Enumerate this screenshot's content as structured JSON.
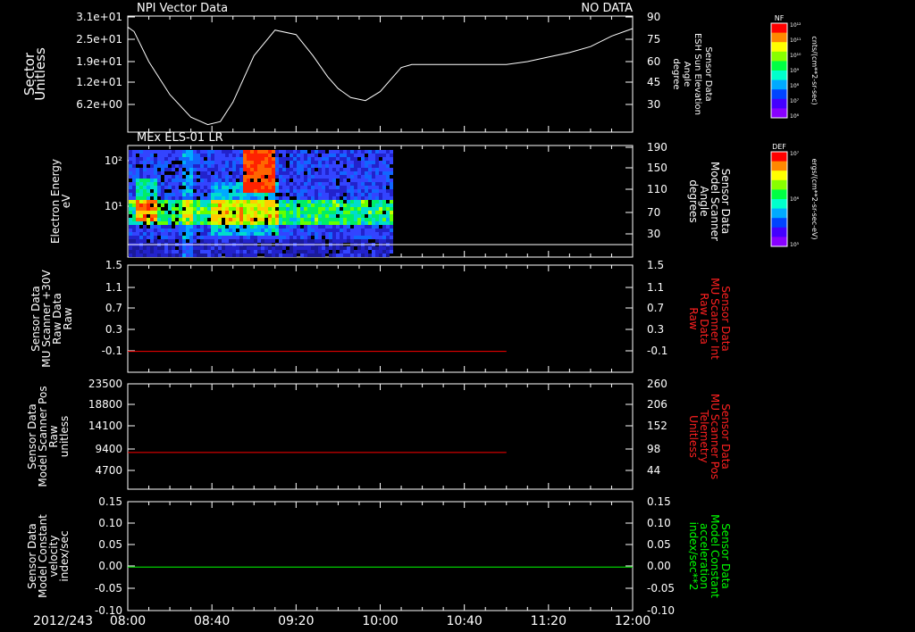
{
  "chart_data": [
    {
      "type": "line",
      "title": "NPI Vector Data",
      "status": "NO DATA",
      "ylabel": [
        "Sector",
        "Unitless"
      ],
      "y_ticks": [
        "3.1e+01",
        "2.5e+01",
        "1.9e+01",
        "1.2e+01",
        "6.2e+00"
      ],
      "ylim": [
        0,
        31
      ],
      "y2label": [
        "Sensor Data",
        "ESH Sun Elevation",
        "Angle",
        "degree"
      ],
      "y2_ticks": [
        "90",
        "75",
        "60",
        "45",
        "30"
      ],
      "y2lim": [
        15,
        90
      ],
      "series": [
        {
          "color": "#ffffff",
          "axis": "right",
          "x": [
            480,
            483,
            490,
            500,
            510,
            518,
            524,
            530,
            540,
            550,
            560,
            568,
            575,
            580,
            586,
            593,
            600,
            610,
            615,
            620,
            660,
            700,
            685,
            690,
            692,
            695,
            698,
            700,
            705,
            715,
            720
          ],
          "y": [
            85,
            82,
            62,
            40,
            25,
            20,
            22,
            35,
            66,
            83,
            80,
            66,
            52,
            44,
            38,
            36,
            42,
            58,
            60,
            60,
            60,
            60,
            60,
            60,
            60,
            62,
            65,
            68,
            72,
            79,
            84
          ]
        }
      ]
    },
    {
      "type": "heatmap",
      "title": "MEx ELS-01 LR",
      "ylabel": [
        "Electron Energy",
        "eV"
      ],
      "y_ticks": [
        "10²",
        "10¹"
      ],
      "y2label": [
        "Sensor Data",
        "Model Scanner",
        "Angle",
        "degrees"
      ],
      "y2_ticks": [
        "190",
        "150",
        "110",
        "70",
        "30"
      ],
      "data_end": "10:05",
      "colorbar": {
        "label": "DEF",
        "unit": "ergs/(cm**2-sr-sec-eV)",
        "ticks": [
          "10⁷",
          "10⁶",
          "10⁵"
        ]
      }
    },
    {
      "type": "line",
      "ylabel": [
        "Sensor Data",
        "MU Scanner +30V",
        "Raw Data",
        "Raw"
      ],
      "y_ticks": [
        "1.5",
        "1.1",
        "0.7",
        "0.3",
        "-0.1"
      ],
      "ylim": [
        -0.3,
        1.5
      ],
      "y2label": [
        "Sensor Data",
        "MU Scanner Int",
        "Raw Data",
        "Raw"
      ],
      "y2_ticks": [
        "1.5",
        "1.1",
        "0.7",
        "0.3",
        "-0.1"
      ],
      "series": [
        {
          "color": "#ff0000",
          "x": [
            480,
            660
          ],
          "y": [
            0.05,
            0.05
          ]
        }
      ]
    },
    {
      "type": "line",
      "ylabel": [
        "Sensor Data",
        "Model Scanner Pos",
        "Raw",
        "unitless"
      ],
      "y_ticks": [
        "23500",
        "18800",
        "14100",
        "9400",
        "4700"
      ],
      "ylim": [
        0,
        23500
      ],
      "y2label": [
        "Sensor Data",
        "MU Scanner Pos",
        "Telemetry",
        "Unitless"
      ],
      "y2_ticks": [
        "260",
        "206",
        "152",
        "98",
        "44"
      ],
      "series": [
        {
          "color": "#ff0000",
          "x": [
            480,
            660
          ],
          "y": [
            8200,
            8200
          ]
        }
      ]
    },
    {
      "type": "line",
      "ylabel": [
        "Sensor Data",
        "Model Constant",
        "velocity",
        "index/sec"
      ],
      "y_ticks": [
        "0.15",
        "0.10",
        "0.05",
        "0.00",
        "-0.05",
        "-0.10"
      ],
      "ylim": [
        -0.1,
        0.15
      ],
      "y2label": [
        "Sensor Data",
        "Model Constant",
        "acceleration",
        "index/sec**2"
      ],
      "y2_ticks": [
        "0.15",
        "0.10",
        "0.05",
        "0.00",
        "-0.05",
        "-0.10"
      ],
      "series": [
        {
          "color": "#00ff00",
          "x": [
            480,
            720
          ],
          "y": [
            0,
            0
          ]
        }
      ]
    }
  ],
  "colorbar_top": {
    "label": "NF",
    "unit": "cnts/(cm**2-sr-sec)",
    "ticks": [
      "10¹²",
      "10¹¹",
      "10¹⁰",
      "10⁹",
      "10⁸",
      "10⁷",
      "10⁶"
    ]
  },
  "x_axis": {
    "date_label": "2012/243",
    "ticks": [
      "08:00",
      "08:40",
      "09:20",
      "10:00",
      "10:40",
      "11:20",
      "12:00"
    ],
    "xlim_minutes": [
      480,
      720
    ]
  }
}
